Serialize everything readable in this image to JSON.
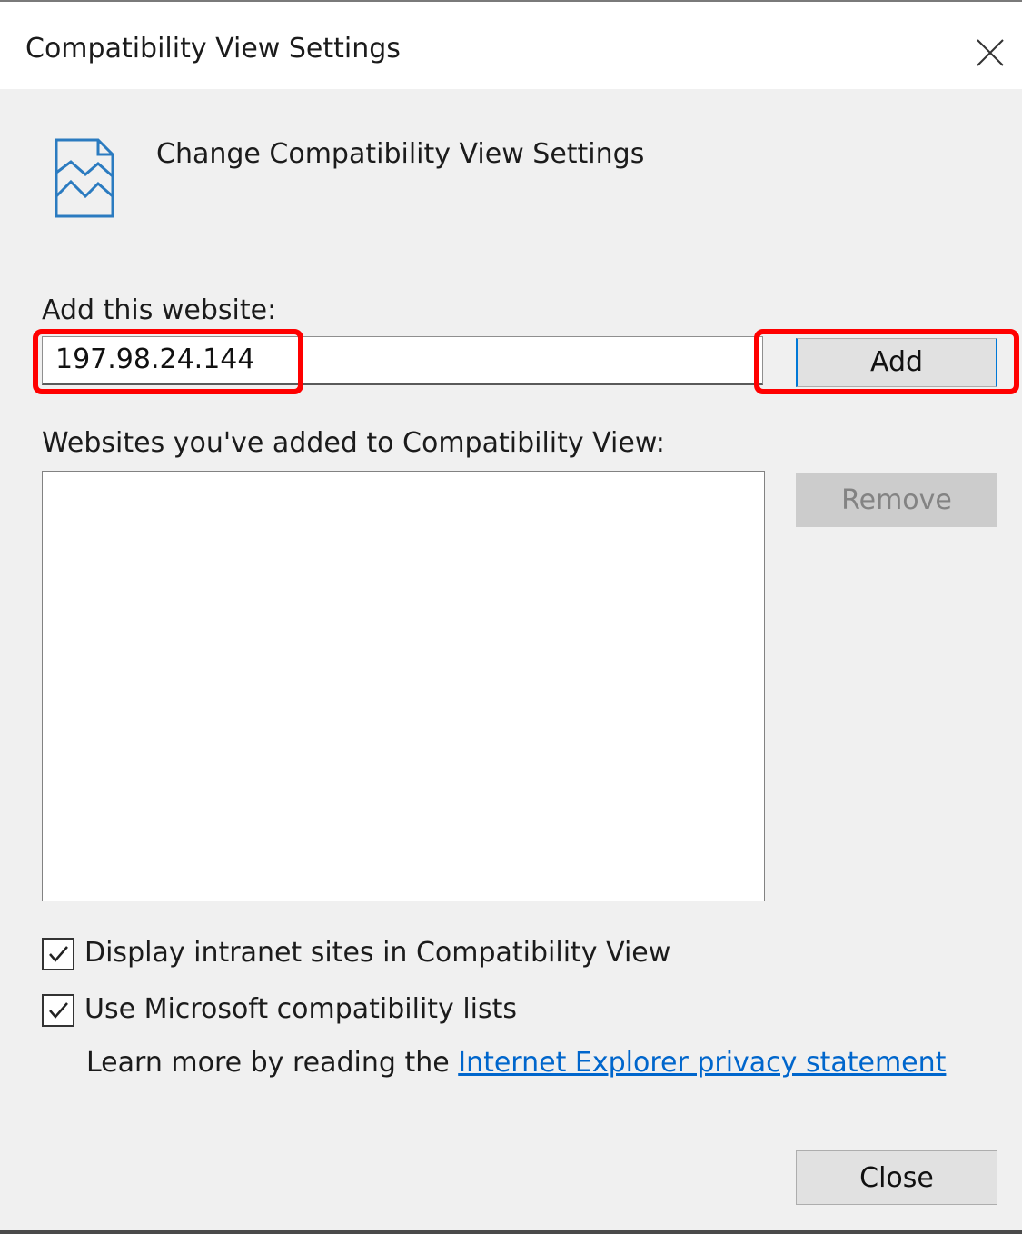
{
  "window": {
    "title": "Compatibility View Settings"
  },
  "header": {
    "text": "Change Compatibility View Settings",
    "icon": "compatibility-page-icon"
  },
  "add_section": {
    "label": "Add this website:",
    "input_value": "197.98.24.144",
    "add_button": "Add"
  },
  "list_section": {
    "label": "Websites you've added to Compatibility View:",
    "items": [],
    "remove_button": "Remove"
  },
  "options": {
    "intranet": {
      "label": "Display intranet sites in Compatibility View",
      "checked": true
    },
    "ms_lists": {
      "label": "Use Microsoft compatibility lists",
      "checked": true
    }
  },
  "learn_more": {
    "prefix": "Learn more by reading the ",
    "link_text": "Internet Explorer privacy statement"
  },
  "footer": {
    "close_button": "Close"
  },
  "colors": {
    "accent": "#0078d7",
    "highlight": "#ff0000",
    "link": "#0066cc"
  }
}
